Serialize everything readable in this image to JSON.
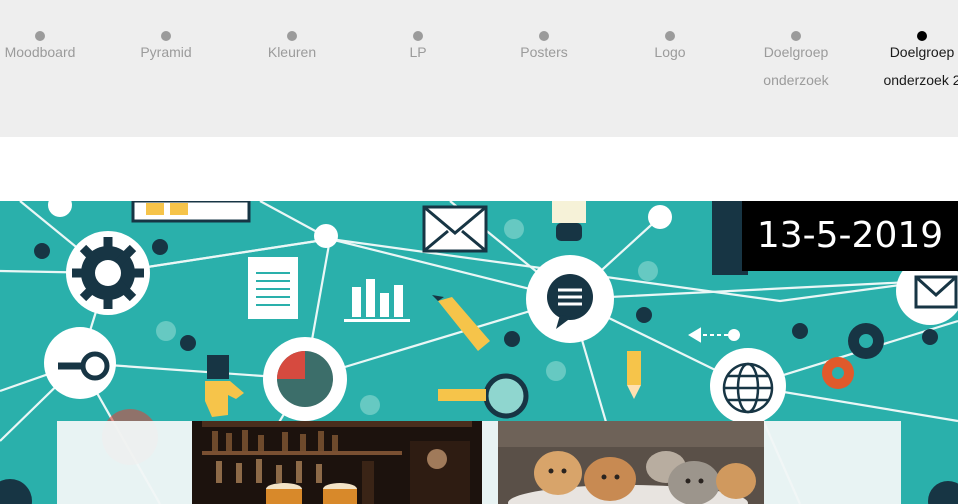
{
  "timeline": {
    "items": [
      {
        "label": "Moodboard",
        "active": false
      },
      {
        "label": "Pyramid",
        "active": false
      },
      {
        "label": "Kleuren",
        "active": false
      },
      {
        "label": "LP",
        "active": false
      },
      {
        "label": "Posters",
        "active": false
      },
      {
        "label": "Logo",
        "active": false
      },
      {
        "label": "Doelgroep onderzoek",
        "active": false
      },
      {
        "label": "Doelgroep onderzoek 2",
        "active": true
      }
    ]
  },
  "post": {
    "date": "13-5-2019"
  },
  "colors": {
    "timeline_bg": "#eeeeee",
    "hero_teal": "#2ab0ab",
    "inactive_text": "#9b9b9b",
    "badge_bg": "#000000"
  }
}
